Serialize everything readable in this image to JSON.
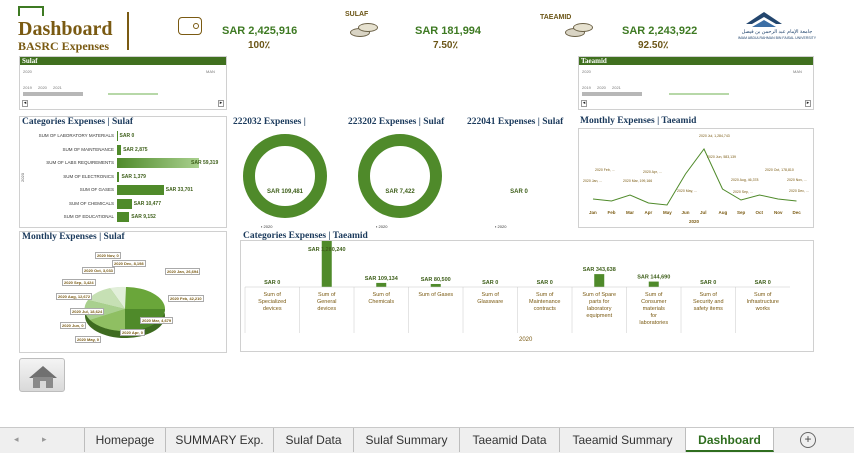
{
  "header": {
    "title": "Dashboard",
    "subtitle": "BASRC Expenses",
    "kpis": [
      {
        "tag": "",
        "value": "SAR 2,425,916",
        "pct": "100٪"
      },
      {
        "tag": "SULAF",
        "value": "SAR 181,994",
        "pct": "7.50٪"
      },
      {
        "tag": "TAEAMID",
        "value": "SAR 2,243,922",
        "pct": "92.50٪"
      }
    ],
    "university_name": "جامعة الإمام عبد الرحمن بن فيصل",
    "university_name_en": "IMAM ABDULRAHMAN BIN FAISAL UNIVERSITY"
  },
  "slicers": {
    "sulaf": {
      "title": "Sulaf",
      "year": "2020",
      "months": "MAN",
      "years_row": [
        "2019",
        "2020",
        "2021"
      ]
    },
    "taeamid": {
      "title": "Taeamid",
      "year": "2020",
      "months": "MAN",
      "years_row": [
        "2019",
        "2020",
        "2021"
      ]
    }
  },
  "cat_sulaf": {
    "title": "Categories Expenses | Sulaf",
    "year": "2020",
    "items": [
      {
        "label": "SUM OF LABORATORY MATERIALS",
        "value": "SAR 0",
        "frac": 0.0
      },
      {
        "label": "SUM OF MAINTENANCE",
        "value": "SAR 2,875",
        "frac": 0.05
      },
      {
        "label": "SUM OF LABS REQUIREMENTS",
        "value": "SAR 59,319",
        "frac": 1.0
      },
      {
        "label": "SUM OF ELECTRONICS",
        "value": "SAR 1,379",
        "frac": 0.03
      },
      {
        "label": "SUM OF GASES",
        "value": "SAR 33,701",
        "frac": 0.57
      },
      {
        "label": "SUM OF CHEMICALS",
        "value": "SAR 10,477",
        "frac": 0.18
      },
      {
        "label": "SUM OF EDUCATIONAL",
        "value": "SAR 9,152",
        "frac": 0.15
      }
    ]
  },
  "monthly_sulaf": {
    "title": "Monthly Expenses | Sulaf",
    "labels": [
      "2020 Nov, 0",
      "2020 Dec, 8,198",
      "2020 Oct, 3,033",
      "2020 Sep, 3,424",
      "2020 Aug, 12,672",
      "2020 Jul, 18,624",
      "2020 Jun, 0",
      "2020 May, 0",
      "2020 Apr, 0",
      "2020 Mar, 4,679",
      "2020 Feb, 42,210",
      "2020 Jan, 26,694"
    ]
  },
  "donuts": [
    {
      "title": "222032 Expenses |",
      "value": "SAR 109,481",
      "legend": "2020"
    },
    {
      "title": "223202 Expenses | Sulaf",
      "value": "SAR 7,422",
      "legend": "2020"
    },
    {
      "title": "222041 Expenses | Sulaf",
      "value": "SAR 0",
      "legend": "2020"
    }
  ],
  "monthly_taeamid": {
    "title": "Monthly Expenses | Taeamid",
    "months": [
      "Jan",
      "Feb",
      "Mar",
      "Apr",
      "May",
      "Jun",
      "Jul",
      "Aug",
      "Sep",
      "Oct",
      "Nov",
      "Dec"
    ],
    "year": "2020",
    "callouts": [
      "2020 Jul, 1,284,743",
      "2020 Jun, 583,139",
      "2020 Feb, ...",
      "2020 Jan, ...",
      "2020 Mar, 199,166",
      "2020 Apr, ...",
      "2020 Aug, 46,378",
      "2020 Oct, 178,810",
      "2020 Nov, ...",
      "2020 Dec, ...",
      "2020 May, ...",
      "2020 Sep, ..."
    ]
  },
  "cat_taeamid": {
    "title": "Categories Expenses | Taeamid",
    "year": "2020",
    "chart_data": {
      "type": "bar",
      "categories": [
        "Sum of Specialized devices",
        "Sum of General devices",
        "Sum of Chemicals",
        "Sum of Gases",
        "Sum of Glassware",
        "Sum of Maintenance contracts",
        "Sum of Spare parts for laboratory equipment",
        "Sum of Consumer materials for laboratories",
        "Sum of Security and safety items",
        "Sum of Infrastructure works"
      ],
      "values": [
        0,
        1280240,
        109134,
        80500,
        0,
        0,
        343638,
        144690,
        0,
        0
      ],
      "value_labels": [
        "SAR 0",
        "SAR 1,280,240",
        "SAR 109,134",
        "SAR 80,500",
        "SAR 0",
        "SAR 0",
        "SAR 343,638",
        "SAR 144,690",
        "SAR 0",
        "SAR 0"
      ],
      "xlabel": "2020"
    }
  },
  "tabs": [
    "Homepage",
    "SUMMARY Exp.",
    "Sulaf Data",
    "Sulaf Summary",
    "Taeamid Data",
    "Taeamid Summary",
    "Dashboard"
  ],
  "active_tab": "Dashboard",
  "colors": {
    "accent": "#4f8a2a",
    "title": "#7a5a12",
    "kpi": "#3e7a23"
  }
}
